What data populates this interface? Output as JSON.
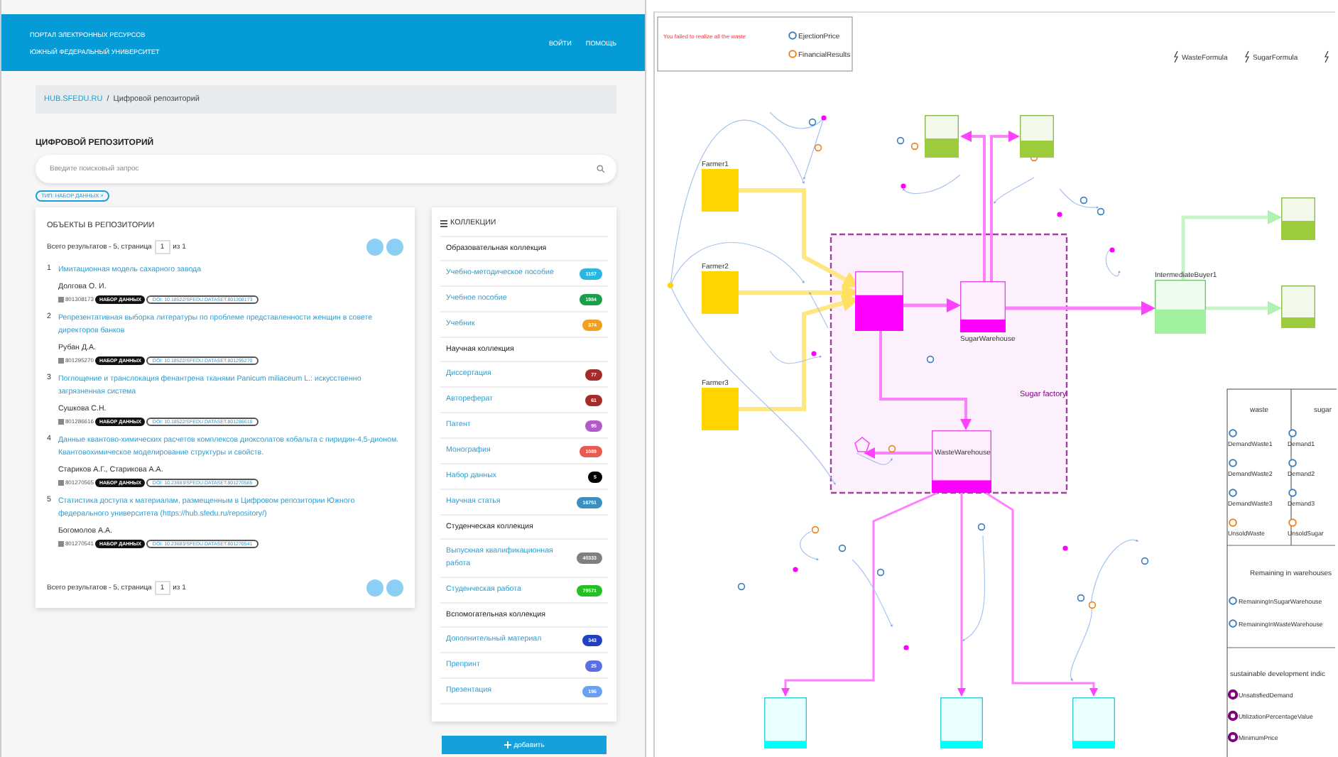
{
  "portal": {
    "title_lines": [
      "ПОРТАЛ ЭЛЕКТРОННЫХ РЕСУРСОВ",
      "ЮЖНЫЙ ФЕДЕРАЛЬНЫЙ УНИВЕРСИТЕТ"
    ],
    "nav": [
      "ВОЙТИ",
      "ПОМОЩЬ"
    ],
    "breadcrumb": {
      "link": "HUB.SFEDU.RU",
      "separator": "/",
      "current": "Цифровой репозиторий"
    },
    "heading": "ЦИФРОВОЙ РЕПОЗИТОРИЙ",
    "search": {
      "placeholder": "Введите поисковый запрос"
    },
    "filter_chip": "ТИП: НАБОР ДАННЫХ ×",
    "objects": {
      "title": "ОБЪЕКТЫ В РЕПОЗИТОРИИ",
      "pager_top": {
        "prefix": "Всего результатов - 5, страница",
        "page": "1",
        "suffix": "из 1"
      },
      "items": [
        {
          "number": "1",
          "title": "Имитационная модель сахарного завода",
          "authors": "Долгова О. И.",
          "id": "801308173",
          "type": "НАБОР ДАННЫХ",
          "doi": "DOI: 10.18522/SFEDU.DATASET.801308173"
        },
        {
          "number": "2",
          "title": "Репрезентативная выборка литературы по проблеме представленности женщин в совете директоров банков",
          "authors": "Рубан Д.А.",
          "id": "801295270",
          "type": "НАБОР ДАННЫХ",
          "doi": "DOI: 10.18522/SFEDU.DATASET.801295270"
        },
        {
          "number": "3",
          "title": "Поглощение и транслокация фенантрена тканями Panicum miliaceum L.: искусственно загрязненная система",
          "authors": "Сушкова С.Н.",
          "id": "801286616",
          "type": "НАБОР ДАННЫХ",
          "doi": "DOI: 10.18522/SFEDU.DATASET.801286616"
        },
        {
          "number": "4",
          "title": "Данные квантово-химических расчетов комплексов диоксолатов кобальта с пиридин-4,5-дионом. Квантовохимическое моделирование структуры и свойств.",
          "authors": "Стариков А.Г., Старикова А.А.",
          "id": "801270565",
          "type": "НАБОР ДАННЫХ",
          "doi": "DOI: 10.23683/SFEDU.DATASET.801270565"
        },
        {
          "number": "5",
          "title": "Статистика доступа к материалам, размещенным в Цифровом репозитории Южного федерального университета (https://hub.sfedu.ru/repository/)",
          "authors": "Богомолов А.А.",
          "id": "801270541",
          "type": "НАБОР ДАННЫХ",
          "doi": "DOI: 10.23683/SFEDU.DATASET.801270541"
        }
      ],
      "pager_bottom": {
        "prefix": "Всего результатов - 5, страница",
        "page": "1",
        "suffix": "из 1"
      }
    },
    "collections": {
      "title": "КОЛЛЕКЦИИ",
      "groups": [
        {
          "name": "Образовательная коллекция",
          "items": [
            {
              "label": "Учебно-методическое пособие",
              "count": "1157",
              "color": "#29b6e0"
            },
            {
              "label": "Учебное пособие",
              "count": "1984",
              "color": "#1a9e4a"
            },
            {
              "label": "Учебник",
              "count": "374",
              "color": "#f0a020"
            }
          ]
        },
        {
          "name": "Научная коллекция",
          "items": [
            {
              "label": "Диссертация",
              "count": "77",
              "color": "#a52a2a"
            },
            {
              "label": "Автореферат",
              "count": "61",
              "color": "#a52a2a"
            },
            {
              "label": "Патент",
              "count": "95",
              "color": "#b05cc8"
            },
            {
              "label": "Монография",
              "count": "1089",
              "color": "#e85a4f"
            },
            {
              "label": "Набор данных",
              "count": "5",
              "color": "#000000"
            },
            {
              "label": "Научная статья",
              "count": "16751",
              "color": "#3a8fc0"
            }
          ]
        },
        {
          "name": "Студенческая коллекция",
          "items": [
            {
              "label": "Выпускная квалификационная работа",
              "count": "40333",
              "color": "#808080"
            },
            {
              "label": "Студенческая работа",
              "count": "79571",
              "color": "#22c022"
            }
          ]
        },
        {
          "name": "Вспомогательная коллекция",
          "items": [
            {
              "label": "Дополнительный материал",
              "count": "343",
              "color": "#2040c0"
            },
            {
              "label": "Препринт",
              "count": "25",
              "color": "#5a70e0"
            },
            {
              "label": "Презентация",
              "count": "196",
              "color": "#6aa0f0"
            }
          ]
        }
      ],
      "add_button": "добавить"
    }
  },
  "model": {
    "message": "You failed to realize all the waste",
    "indicators": [
      {
        "label": "EjectionPrice",
        "kind": "parameter"
      },
      {
        "label": "FinancialResults",
        "kind": "output"
      }
    ],
    "formulas": [
      "WasteFormula",
      "SugarFormula"
    ],
    "region": "Sugar factory",
    "nodes": [
      {
        "kind": "farmer",
        "label": "Farmer1",
        "level": 1
      },
      {
        "kind": "farmer",
        "label": "Farmer2",
        "level": 1
      },
      {
        "kind": "farmer",
        "label": "Farmer3",
        "level": 1
      },
      {
        "kind": "store",
        "level": 0.45
      },
      {
        "kind": "store",
        "level": 0.4
      },
      {
        "kind": "factory",
        "level": 0.6
      },
      {
        "kind": "factory",
        "label": "SugarWarehouse",
        "level": 0.25
      },
      {
        "kind": "factory",
        "label": "WasteWarehouse",
        "level": 0.2
      },
      {
        "kind": "buyer",
        "label": "IntermediateBuyer1",
        "level": 0.45
      },
      {
        "kind": "store",
        "level": 0.45
      },
      {
        "kind": "store",
        "level": 0.25
      },
      {
        "kind": "retail",
        "level": 0.15
      },
      {
        "kind": "retail",
        "level": 0.15
      },
      {
        "kind": "retail",
        "level": 0.15
      }
    ],
    "legend": {
      "columns": [
        {
          "title": "waste",
          "items": [
            {
              "label": "DemandWaste1",
              "kind": "parameter"
            },
            {
              "label": "DemandWaste2",
              "kind": "parameter"
            },
            {
              "label": "DemandWaste3",
              "kind": "parameter"
            },
            {
              "label": "UnsoldWaste",
              "kind": "output"
            }
          ]
        },
        {
          "title": "sugar",
          "items": [
            {
              "label": "Demand1",
              "kind": "parameter"
            },
            {
              "label": "Demand2",
              "kind": "parameter"
            },
            {
              "label": "Demand3",
              "kind": "parameter"
            },
            {
              "label": "UnsoldSugar",
              "kind": "output"
            }
          ]
        }
      ],
      "remaining": {
        "title": "Remaining in warehouses",
        "items": [
          {
            "label": "RemainingInSugarWarehouse",
            "kind": "parameter"
          },
          {
            "label": "RemainingInWasteWarehouse",
            "kind": "parameter"
          }
        ]
      },
      "sustainability": {
        "title": "sustainable development indic",
        "items": [
          {
            "label": "UnsatisfiedDemand",
            "kind": "indicator"
          },
          {
            "label": "UtilizationPercentageValue",
            "kind": "indicator"
          },
          {
            "label": "MinimumPrice",
            "kind": "indicator"
          }
        ]
      }
    }
  }
}
